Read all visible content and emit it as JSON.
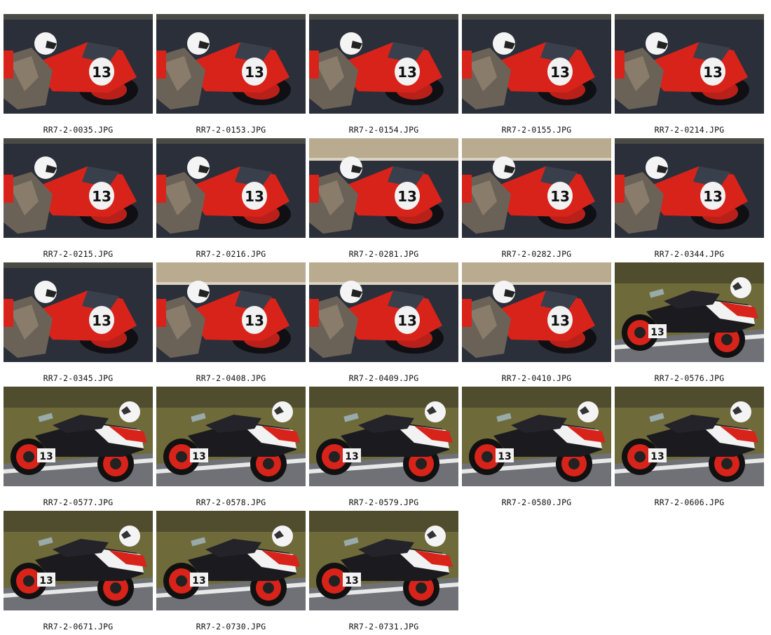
{
  "gallery": {
    "items": [
      {
        "filename": "RR7-2-0035.JPG",
        "scene": "front",
        "bg": "dark"
      },
      {
        "filename": "RR7-2-0153.JPG",
        "scene": "front",
        "bg": "dark"
      },
      {
        "filename": "RR7-2-0154.JPG",
        "scene": "front",
        "bg": "dark"
      },
      {
        "filename": "RR7-2-0155.JPG",
        "scene": "front",
        "bg": "dark"
      },
      {
        "filename": "RR7-2-0214.JPG",
        "scene": "front",
        "bg": "dark"
      },
      {
        "filename": "RR7-2-0215.JPG",
        "scene": "front",
        "bg": "dark"
      },
      {
        "filename": "RR7-2-0216.JPG",
        "scene": "front",
        "bg": "dark"
      },
      {
        "filename": "RR7-2-0281.JPG",
        "scene": "front",
        "bg": "sand"
      },
      {
        "filename": "RR7-2-0282.JPG",
        "scene": "front",
        "bg": "sand"
      },
      {
        "filename": "RR7-2-0344.JPG",
        "scene": "front",
        "bg": "dark"
      },
      {
        "filename": "RR7-2-0345.JPG",
        "scene": "front",
        "bg": "dark"
      },
      {
        "filename": "RR7-2-0408.JPG",
        "scene": "front",
        "bg": "sand"
      },
      {
        "filename": "RR7-2-0409.JPG",
        "scene": "front",
        "bg": "sand"
      },
      {
        "filename": "RR7-2-0410.JPG",
        "scene": "front",
        "bg": "sand"
      },
      {
        "filename": "RR7-2-0576.JPG",
        "scene": "side",
        "bg": "grass"
      },
      {
        "filename": "RR7-2-0577.JPG",
        "scene": "side",
        "bg": "grass"
      },
      {
        "filename": "RR7-2-0578.JPG",
        "scene": "side",
        "bg": "grass"
      },
      {
        "filename": "RR7-2-0579.JPG",
        "scene": "side",
        "bg": "grass"
      },
      {
        "filename": "RR7-2-0580.JPG",
        "scene": "side",
        "bg": "grass"
      },
      {
        "filename": "RR7-2-0606.JPG",
        "scene": "side",
        "bg": "grass"
      },
      {
        "filename": "RR7-2-0671.JPG",
        "scene": "side",
        "bg": "grass"
      },
      {
        "filename": "RR7-2-0730.JPG",
        "scene": "side",
        "bg": "grass"
      },
      {
        "filename": "RR7-2-0731.JPG",
        "scene": "side",
        "bg": "grass"
      }
    ],
    "race_number": "13",
    "colors": {
      "asphalt": "#2b2f3a",
      "sand": "#b9ab8f",
      "grass": "#6e6a3a",
      "fairing_red": "#d8231b",
      "fairing_white": "#f2f2f2",
      "frame_black": "#1b1b1f",
      "helmet": "#f4f4f4"
    }
  }
}
